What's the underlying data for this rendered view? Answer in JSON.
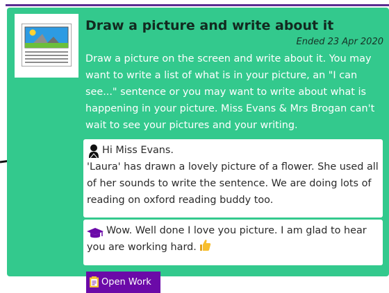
{
  "assignment": {
    "title": "Draw a picture and write about it",
    "ended": "Ended 23 Apr 2020",
    "description": "Draw a picture on the screen and write about it. You may want to write a list of what is in your picture, an \"I can see...\" sentence or you may want to write about what is happening in your picture. Miss Evans & Mrs Brogan can't wait to see your pictures and your writing."
  },
  "comments": [
    {
      "icon": "student-icon",
      "first_line": "Hi Miss Evans.",
      "body": "'Laura' has drawn a lovely picture of a flower. She used all of her sounds to write the sentence. We are doing lots of reading on oxford reading buddy too."
    },
    {
      "icon": "teacher-cap-icon",
      "text": "Wow. Well done I love you picture. I am glad to hear you are working hard.",
      "emoji": "thumbs-up-icon"
    }
  ],
  "button": {
    "label": "Open Work",
    "icon": "document-icon"
  },
  "colors": {
    "card": "#33c98d",
    "accent": "#5a2d91",
    "button": "#6b0aa8"
  }
}
